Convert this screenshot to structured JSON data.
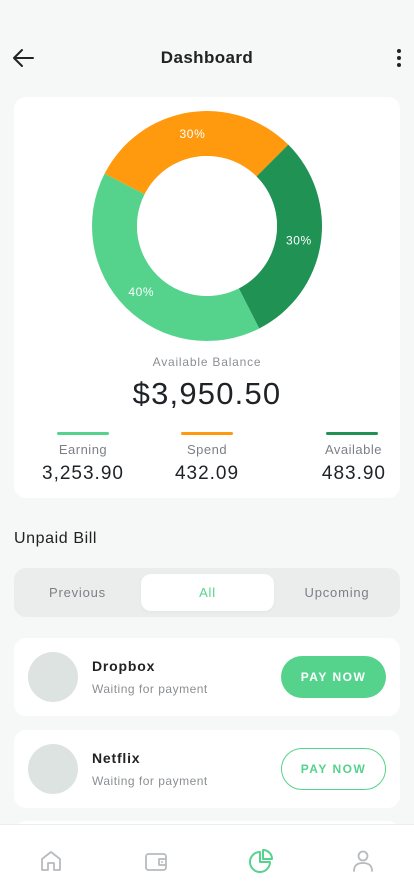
{
  "header": {
    "title": "Dashboard"
  },
  "summary": {
    "balance_label": "Available Balance",
    "balance_value": "$3,950.50",
    "stats": [
      {
        "label": "Earning",
        "value": "3,253.90",
        "color": "#55d38d"
      },
      {
        "label": "Spend",
        "value": "432.09",
        "color": "#ff9a0f"
      },
      {
        "label": "Available",
        "value": "483.90",
        "color": "#1f9254"
      }
    ]
  },
  "chart_data": {
    "type": "pie",
    "donut": true,
    "slices": [
      {
        "value": 30,
        "label": "30%",
        "color": "#ff9a0f"
      },
      {
        "value": 30,
        "label": "30%",
        "color": "#1f9254"
      },
      {
        "value": 40,
        "label": "40%",
        "color": "#55d38d"
      }
    ]
  },
  "bills": {
    "title": "Unpaid Bill",
    "tabs": [
      {
        "label": "Previous",
        "active": false
      },
      {
        "label": "All",
        "active": true
      },
      {
        "label": "Upcoming",
        "active": false
      }
    ],
    "items": [
      {
        "name": "Dropbox",
        "status": "Waiting for payment",
        "button": "PAY NOW",
        "style": "filled"
      },
      {
        "name": "Netflix",
        "status": "Waiting for payment",
        "button": "PAY NOW",
        "style": "outline"
      }
    ]
  },
  "colors": {
    "accent": "#55d38d",
    "orange": "#ff9a0f",
    "dark_green": "#1f9254",
    "inactive_icon": "#b7bbbd"
  },
  "nav": [
    {
      "icon": "home-icon",
      "active": false
    },
    {
      "icon": "wallet-icon",
      "active": false
    },
    {
      "icon": "pie-chart-icon",
      "active": true
    },
    {
      "icon": "profile-icon",
      "active": false
    }
  ]
}
